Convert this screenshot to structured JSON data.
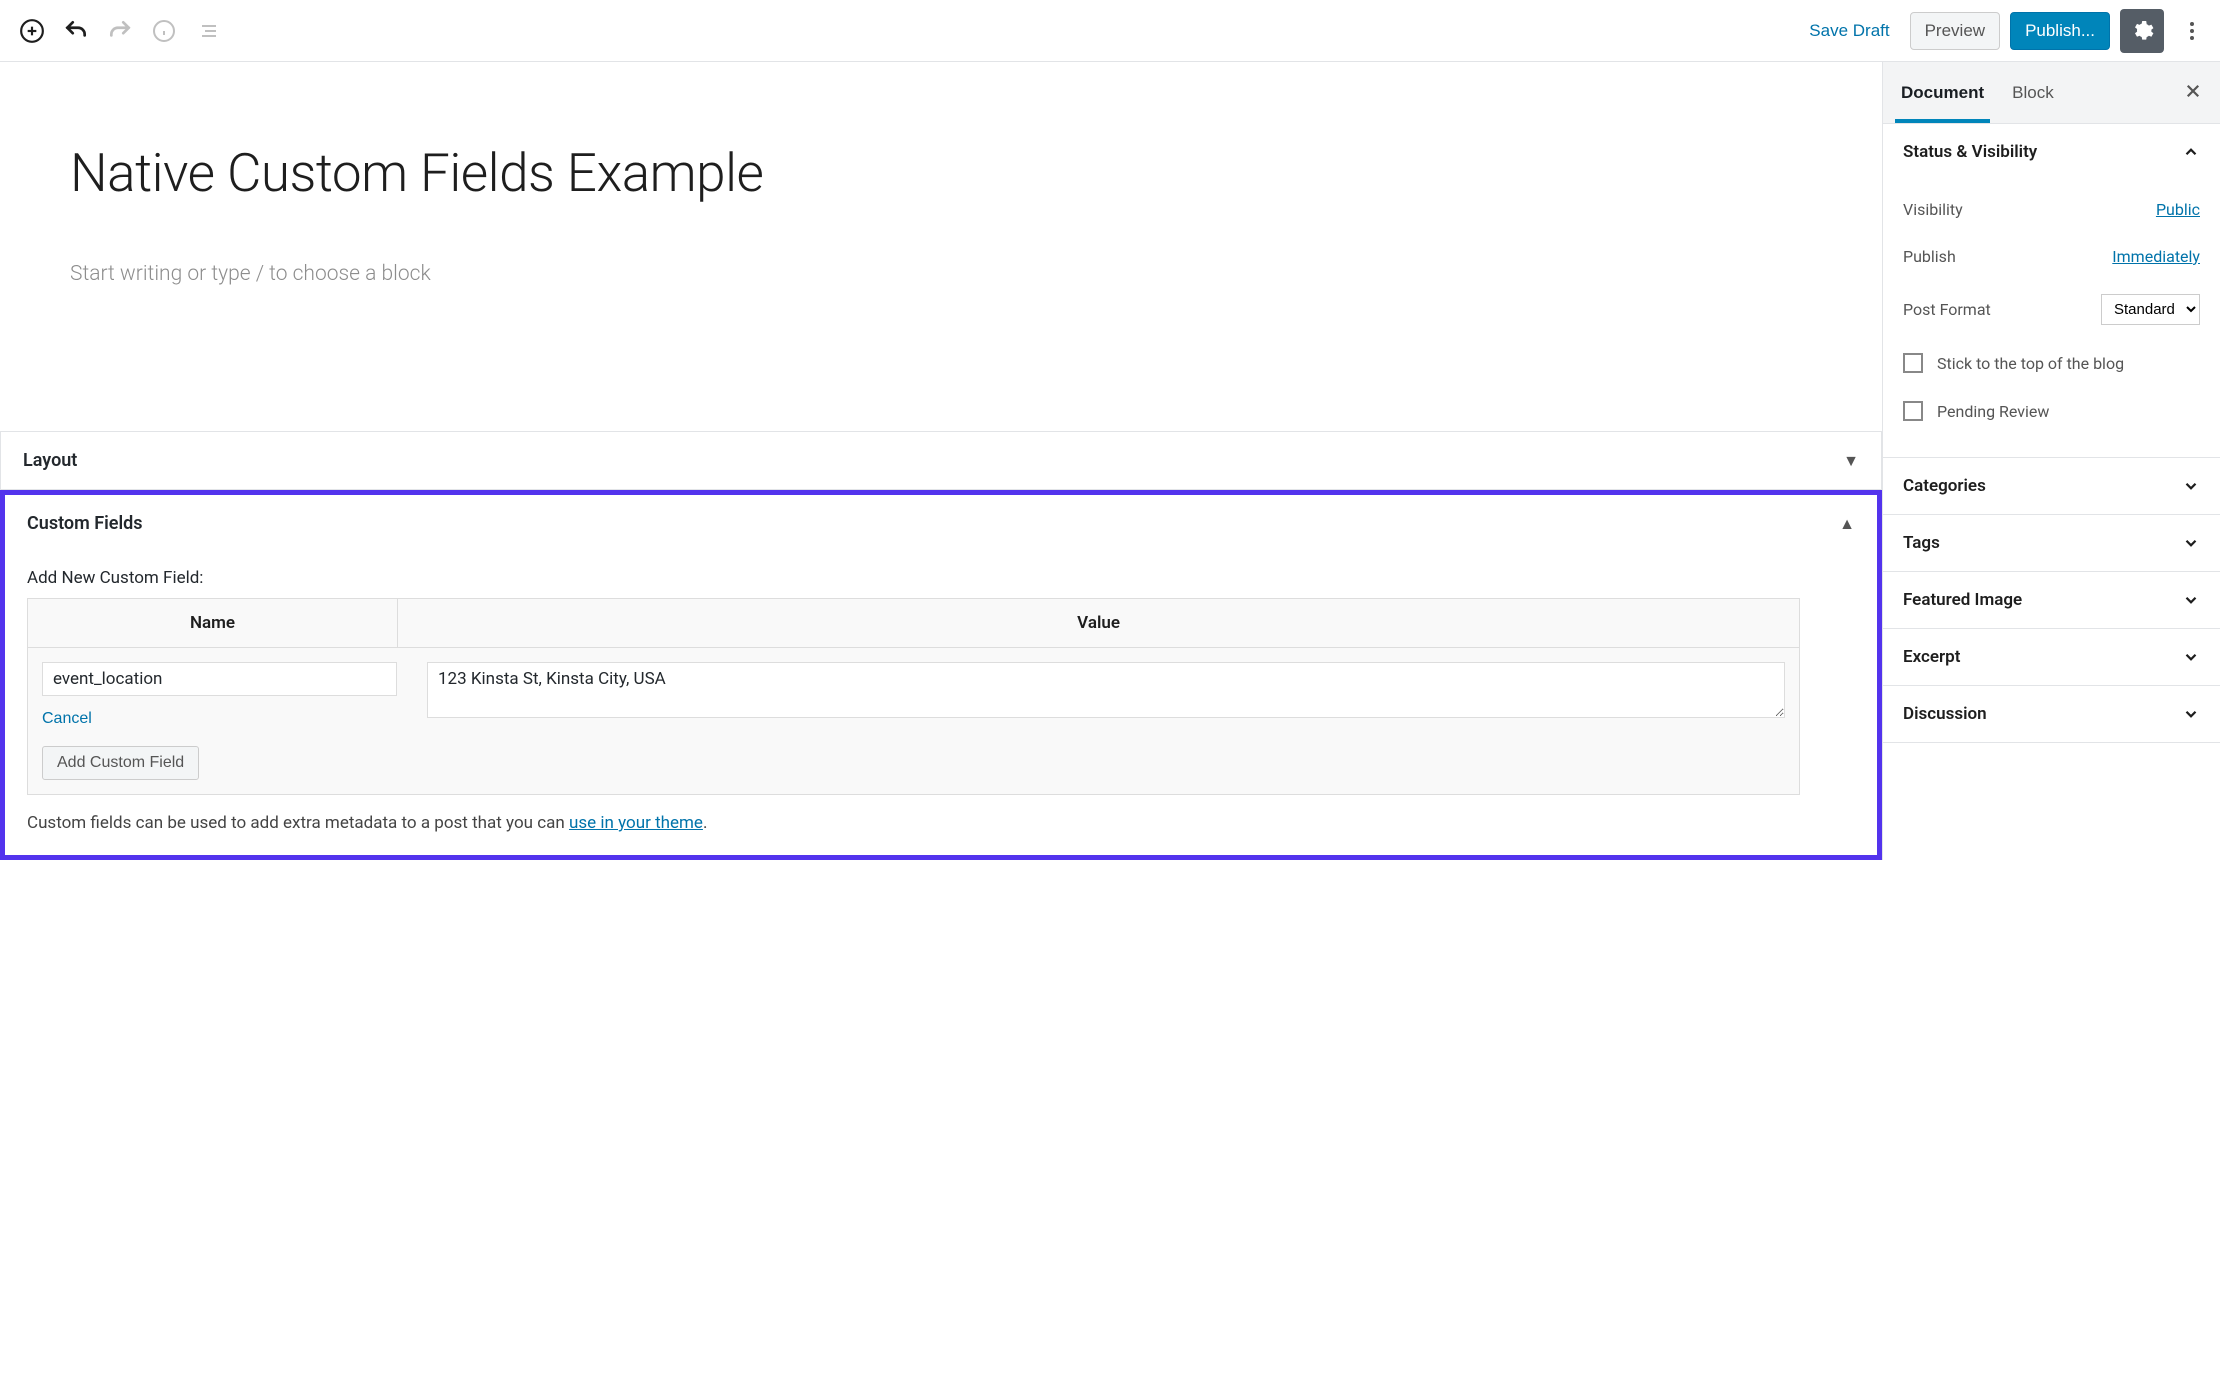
{
  "toolbar": {
    "save_draft": "Save Draft",
    "preview": "Preview",
    "publish": "Publish..."
  },
  "editor": {
    "title": "Native Custom Fields Example",
    "placeholder": "Start writing or type / to choose a block"
  },
  "metaboxes": {
    "layout": {
      "title": "Layout"
    },
    "custom_fields": {
      "title": "Custom Fields",
      "add_new_label": "Add New Custom Field:",
      "name_header": "Name",
      "value_header": "Value",
      "name_value": "event_location",
      "value_value": "123 Kinsta St, Kinsta City, USA",
      "cancel": "Cancel",
      "add_button": "Add Custom Field",
      "hint_prefix": "Custom fields can be used to add extra metadata to a post that you can ",
      "hint_link": "use in your theme",
      "hint_suffix": "."
    }
  },
  "sidebar": {
    "tabs": {
      "document": "Document",
      "block": "Block"
    },
    "status_visibility": {
      "title": "Status & Visibility",
      "visibility_label": "Visibility",
      "visibility_value": "Public",
      "publish_label": "Publish",
      "publish_value": "Immediately",
      "post_format_label": "Post Format",
      "post_format_value": "Standard",
      "stick_label": "Stick to the top of the blog",
      "pending_label": "Pending Review"
    },
    "panels": {
      "categories": "Categories",
      "tags": "Tags",
      "featured_image": "Featured Image",
      "excerpt": "Excerpt",
      "discussion": "Discussion"
    }
  }
}
